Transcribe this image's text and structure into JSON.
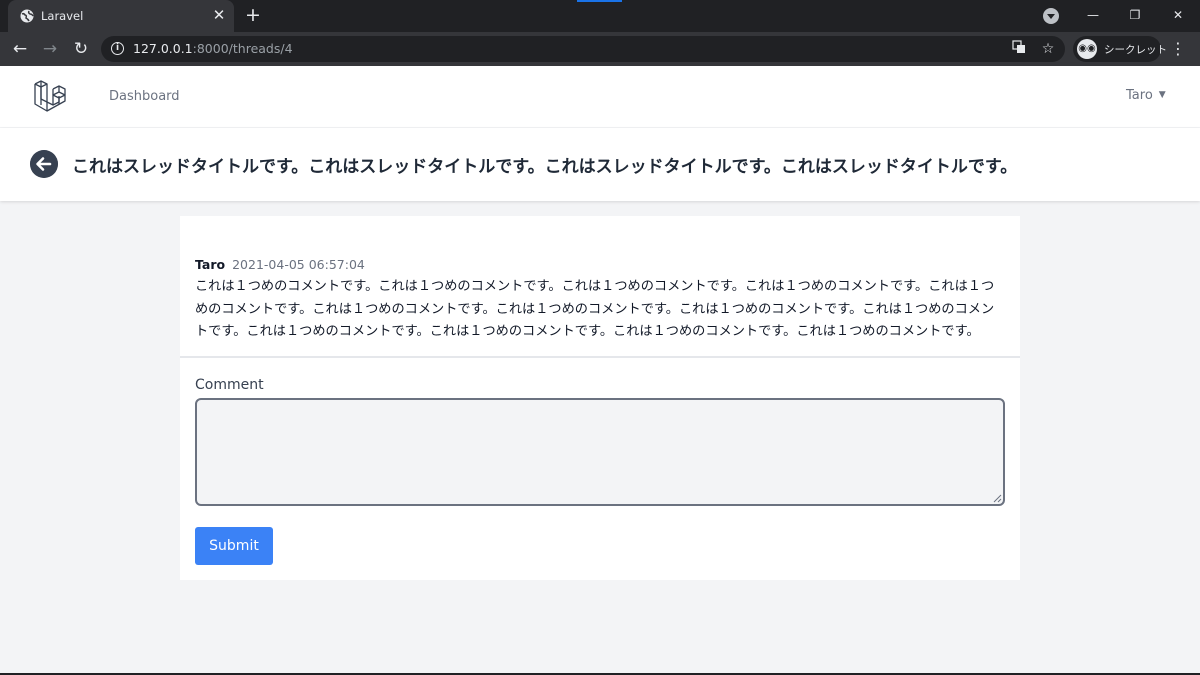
{
  "browser": {
    "tab_title": "Laravel",
    "url_host": "127.0.0.1",
    "url_path": ":8000/threads/4",
    "incognito_label": "シークレット"
  },
  "app_nav": {
    "dashboard_label": "Dashboard",
    "user_name": "Taro"
  },
  "page": {
    "title": "これはスレッドタイトルです。これはスレッドタイトルです。これはスレッドタイトルです。これはスレッドタイトルです。"
  },
  "comment": {
    "author": "Taro",
    "timestamp": "2021-04-05 06:57:04",
    "body": "これは１つめのコメントです。これは１つめのコメントです。これは１つめのコメントです。これは１つめのコメントです。これは１つめのコメントです。これは１つめのコメントです。これは１つめのコメントです。これは１つめのコメントです。これは１つめのコメントです。これは１つめのコメントです。これは１つめのコメントです。これは１つめのコメントです。これは１つめのコメントです。"
  },
  "form": {
    "comment_label": "Comment",
    "comment_value": "",
    "submit_label": "Submit"
  },
  "colors": {
    "primary_button": "#3b82f6",
    "page_background": "#f3f4f6"
  }
}
